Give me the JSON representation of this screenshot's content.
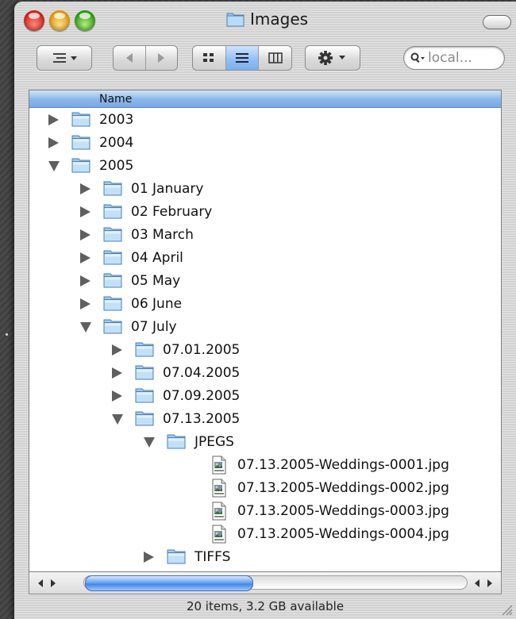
{
  "window": {
    "title": "Images",
    "status_bar": "20 items, 3.2 GB available"
  },
  "toolbar": {
    "search_placeholder": "local...",
    "view_modes": [
      "icon",
      "list",
      "column"
    ],
    "active_view": "list"
  },
  "list": {
    "column_name": "Name",
    "rows": [
      {
        "name": "2003",
        "type": "folder",
        "level": 0,
        "expanded": false
      },
      {
        "name": "2004",
        "type": "folder",
        "level": 0,
        "expanded": false
      },
      {
        "name": "2005",
        "type": "folder",
        "level": 0,
        "expanded": true
      },
      {
        "name": "01 January",
        "type": "folder",
        "level": 1,
        "expanded": false
      },
      {
        "name": "02 February",
        "type": "folder",
        "level": 1,
        "expanded": false
      },
      {
        "name": "03 March",
        "type": "folder",
        "level": 1,
        "expanded": false
      },
      {
        "name": "04 April",
        "type": "folder",
        "level": 1,
        "expanded": false
      },
      {
        "name": "05 May",
        "type": "folder",
        "level": 1,
        "expanded": false
      },
      {
        "name": "06 June",
        "type": "folder",
        "level": 1,
        "expanded": false
      },
      {
        "name": "07 July",
        "type": "folder",
        "level": 1,
        "expanded": true
      },
      {
        "name": "07.01.2005",
        "type": "folder",
        "level": 2,
        "expanded": false
      },
      {
        "name": "07.04.2005",
        "type": "folder",
        "level": 2,
        "expanded": false
      },
      {
        "name": "07.09.2005",
        "type": "folder",
        "level": 2,
        "expanded": false
      },
      {
        "name": "07.13.2005",
        "type": "folder",
        "level": 2,
        "expanded": true
      },
      {
        "name": "JPEGS",
        "type": "folder",
        "level": 3,
        "expanded": true
      },
      {
        "name": "07.13.2005-Weddings-0001.jpg",
        "type": "file",
        "level": 4
      },
      {
        "name": "07.13.2005-Weddings-0002.jpg",
        "type": "file",
        "level": 4
      },
      {
        "name": "07.13.2005-Weddings-0003.jpg",
        "type": "file",
        "level": 4
      },
      {
        "name": "07.13.2005-Weddings-0004.jpg",
        "type": "file",
        "level": 4
      },
      {
        "name": "TIFFS",
        "type": "folder",
        "level": 3,
        "expanded": false
      }
    ]
  },
  "icons": {
    "folder": "folder-icon",
    "file": "jpeg-file-icon",
    "disclosure_collapsed": "disclosure-right-icon",
    "disclosure_expanded": "disclosure-down-icon"
  },
  "colors": {
    "selection_blue": "#7aa9e4",
    "folder_blue": "#9ec9f0"
  }
}
